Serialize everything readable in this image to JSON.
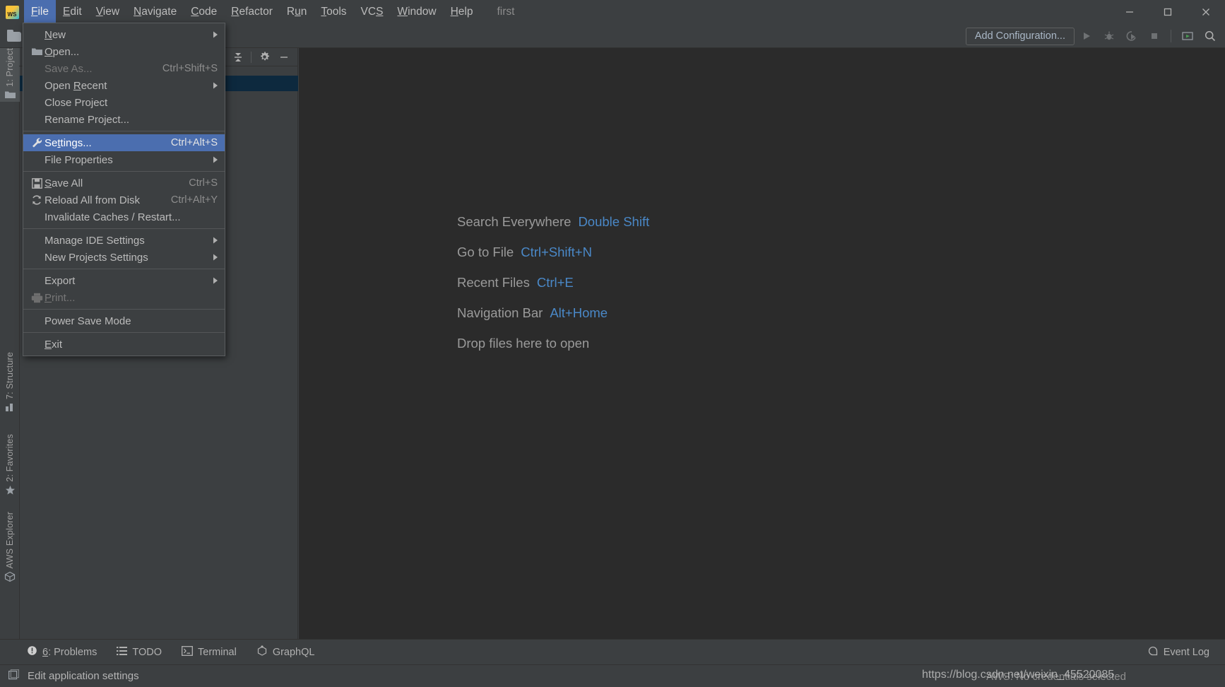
{
  "window": {
    "project_name": "first",
    "logo_text": "WS",
    "controls": {
      "minimize": "minimize-icon",
      "maximize": "maximize-icon",
      "close": "close-icon"
    }
  },
  "menubar": {
    "items": [
      {
        "label": "File",
        "mnemonic": "F",
        "active": true
      },
      {
        "label": "Edit",
        "mnemonic": "E",
        "active": false
      },
      {
        "label": "View",
        "mnemonic": "V",
        "active": false
      },
      {
        "label": "Navigate",
        "mnemonic": "N",
        "active": false
      },
      {
        "label": "Code",
        "mnemonic": "C",
        "active": false
      },
      {
        "label": "Refactor",
        "mnemonic": "R",
        "active": false
      },
      {
        "label": "Run",
        "mnemonic": "u",
        "active": false
      },
      {
        "label": "Tools",
        "mnemonic": "T",
        "active": false
      },
      {
        "label": "VCS",
        "mnemonic": "S",
        "active": false
      },
      {
        "label": "Window",
        "mnemonic": "W",
        "active": false
      },
      {
        "label": "Help",
        "mnemonic": "H",
        "active": false
      }
    ]
  },
  "file_menu": {
    "groups": [
      [
        {
          "label": "New",
          "mnemonic": "N",
          "icon": "",
          "accel": "",
          "submenu": true,
          "disabled": false,
          "selected": false
        },
        {
          "label": "Open...",
          "mnemonic": "O",
          "icon": "folder-icon",
          "accel": "",
          "submenu": false,
          "disabled": false,
          "selected": false
        },
        {
          "label": "Save As...",
          "mnemonic": "",
          "icon": "",
          "accel": "Ctrl+Shift+S",
          "submenu": false,
          "disabled": true,
          "selected": false
        },
        {
          "label": "Open Recent",
          "mnemonic": "R",
          "icon": "",
          "accel": "",
          "submenu": true,
          "disabled": false,
          "selected": false
        },
        {
          "label": "Close Project",
          "mnemonic": "",
          "icon": "",
          "accel": "",
          "submenu": false,
          "disabled": false,
          "selected": false
        },
        {
          "label": "Rename Project...",
          "mnemonic": "",
          "icon": "",
          "accel": "",
          "submenu": false,
          "disabled": false,
          "selected": false
        }
      ],
      [
        {
          "label": "Settings...",
          "mnemonic": "t",
          "icon": "wrench-icon",
          "accel": "Ctrl+Alt+S",
          "submenu": false,
          "disabled": false,
          "selected": true
        },
        {
          "label": "File Properties",
          "mnemonic": "",
          "icon": "",
          "accel": "",
          "submenu": true,
          "disabled": false,
          "selected": false
        }
      ],
      [
        {
          "label": "Save All",
          "mnemonic": "S",
          "icon": "floppy-icon",
          "accel": "Ctrl+S",
          "submenu": false,
          "disabled": false,
          "selected": false
        },
        {
          "label": "Reload All from Disk",
          "mnemonic": "",
          "icon": "refresh-icon",
          "accel": "Ctrl+Alt+Y",
          "submenu": false,
          "disabled": false,
          "selected": false
        },
        {
          "label": "Invalidate Caches / Restart...",
          "mnemonic": "",
          "icon": "",
          "accel": "",
          "submenu": false,
          "disabled": false,
          "selected": false
        }
      ],
      [
        {
          "label": "Manage IDE Settings",
          "mnemonic": "",
          "icon": "",
          "accel": "",
          "submenu": true,
          "disabled": false,
          "selected": false
        },
        {
          "label": "New Projects Settings",
          "mnemonic": "",
          "icon": "",
          "accel": "",
          "submenu": true,
          "disabled": false,
          "selected": false
        }
      ],
      [
        {
          "label": "Export",
          "mnemonic": "",
          "icon": "",
          "accel": "",
          "submenu": true,
          "disabled": false,
          "selected": false
        },
        {
          "label": "Print...",
          "mnemonic": "P",
          "icon": "printer-icon",
          "accel": "",
          "submenu": false,
          "disabled": true,
          "selected": false
        }
      ],
      [
        {
          "label": "Power Save Mode",
          "mnemonic": "",
          "icon": "",
          "accel": "",
          "submenu": false,
          "disabled": false,
          "selected": false
        }
      ],
      [
        {
          "label": "Exit",
          "mnemonic": "E",
          "icon": "",
          "accel": "",
          "submenu": false,
          "disabled": false,
          "selected": false
        }
      ]
    ]
  },
  "toolbar": {
    "open_folder_icon": "folder-icon",
    "add_configuration_label": "Add Configuration...",
    "run_icon": "run-icon",
    "debug_icon": "debug-icon",
    "run_coverage_icon": "run-with-coverage-icon",
    "stop_icon": "stop-icon",
    "show_window_icon": "show-window-icon",
    "search_icon": "search-icon"
  },
  "left_tool_strip": {
    "tabs": [
      {
        "label": "1: Project",
        "icon": "folder-icon",
        "selected": true
      },
      {
        "label": "7: Structure",
        "icon": "structure-icon",
        "selected": false
      },
      {
        "label": "2: Favorites",
        "icon": "star-icon",
        "selected": false
      },
      {
        "label": "AWS Explorer",
        "icon": "aws-cube-icon",
        "selected": false
      }
    ]
  },
  "project_panel": {
    "collapse_all_icon": "collapse-all-icon",
    "settings_icon": "gear-icon",
    "hide_icon": "hide-panel-icon"
  },
  "editor_hints": [
    {
      "label": "Search Everywhere",
      "key": "Double Shift"
    },
    {
      "label": "Go to File",
      "key": "Ctrl+Shift+N"
    },
    {
      "label": "Recent Files",
      "key": "Ctrl+E"
    },
    {
      "label": "Navigation Bar",
      "key": "Alt+Home"
    },
    {
      "label": "Drop files here to open",
      "key": ""
    }
  ],
  "bottom_bar": {
    "items": [
      {
        "label": "6: Problems",
        "mnemonic": "6",
        "icon": "error-circle-icon"
      },
      {
        "label": "TODO",
        "mnemonic": "",
        "icon": "list-icon"
      },
      {
        "label": "Terminal",
        "mnemonic": "",
        "icon": "terminal-icon"
      },
      {
        "label": "GraphQL",
        "mnemonic": "",
        "icon": "graphql-icon"
      }
    ],
    "event_log_label": "Event Log",
    "event_log_icon": "event-log-icon"
  },
  "status_bar": {
    "hint_text": "Edit application settings",
    "hint_icon": "window-icon",
    "aws_status": "AWS: No credentials selected"
  },
  "watermark": {
    "text": "https://blog.csdn.net/weixin_45520085"
  },
  "colors": {
    "bg_chrome": "#3c3f41",
    "bg_editor": "#2b2b2b",
    "accent_selection": "#4b6eaf",
    "tree_selection": "#0d293e",
    "link_blue": "#4a88c7",
    "text": "#bbbbbb",
    "text_dim": "#8d8d8d"
  }
}
